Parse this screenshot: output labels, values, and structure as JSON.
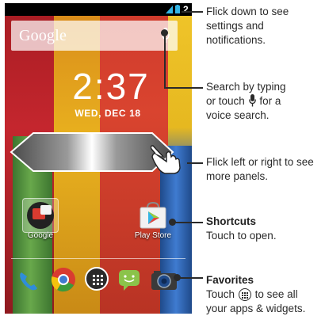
{
  "status_bar": {
    "time": "2"
  },
  "search": {
    "brand": "Google"
  },
  "clock": {
    "time": "2:37",
    "date": "WED, DEC 18"
  },
  "shortcuts": [
    {
      "label": "Google",
      "icon": "google-folder-icon"
    },
    {
      "label": "Play Store",
      "icon": "play-store-icon"
    }
  ],
  "favorites": [
    {
      "icon": "phone-icon"
    },
    {
      "icon": "chrome-icon"
    },
    {
      "icon": "apps-icon"
    },
    {
      "icon": "messaging-icon"
    },
    {
      "icon": "camera-icon"
    }
  ],
  "callouts": {
    "notifications": {
      "lines": [
        "Flick down to see",
        "settings and",
        "notifications."
      ]
    },
    "search": {
      "line1": "Search by typing",
      "line2_pre": "or touch",
      "line2_post": "for a",
      "line3": "voice search."
    },
    "panels": {
      "lines": [
        "Flick left or right to see",
        "more panels."
      ]
    },
    "shortcuts": {
      "title": "Shortcuts",
      "text": "Touch to open."
    },
    "favorites": {
      "title": "Favorites",
      "line1_pre": "Touch",
      "line1_post": "to see all",
      "line2": "your apps & widgets."
    }
  },
  "colors": {
    "stripe_red": "#c4262e",
    "stripe_yellow": "#e9b21f",
    "stripe_green": "#4f8b3b",
    "stripe_blue": "#2f63b4",
    "status_accent": "#33b5e5"
  }
}
